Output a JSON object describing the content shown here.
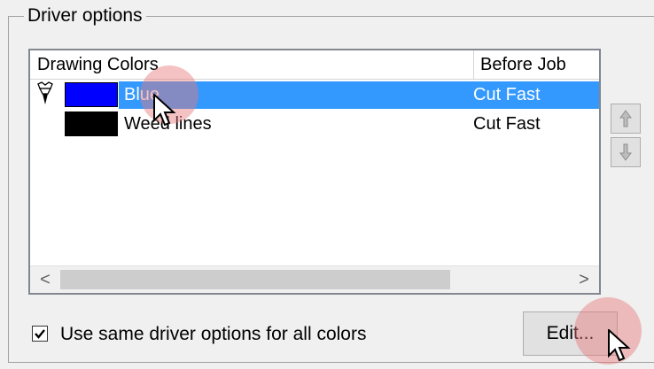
{
  "group": {
    "title": "Driver options"
  },
  "listview": {
    "columns": [
      "Drawing Colors",
      "Before Job"
    ],
    "rows": [
      {
        "name": "Blue",
        "swatch_color": "#0000ff",
        "before_job": "Cut Fast",
        "selected": true,
        "icon": "cutter-icon"
      },
      {
        "name": "Weed lines",
        "swatch_color": "#000000",
        "before_job": "Cut Fast",
        "selected": false
      }
    ]
  },
  "scrollbar": {
    "left_arrow": "<",
    "right_arrow": ">"
  },
  "side_buttons": {
    "up": "move-up-icon",
    "down": "move-down-icon"
  },
  "options": {
    "same_options_label": "Use same driver options for all colors",
    "same_options_checked": true
  },
  "buttons": {
    "edit_label": "Edit..."
  },
  "colors": {
    "selection": "#3399ff",
    "click_highlight": "#e67878"
  }
}
